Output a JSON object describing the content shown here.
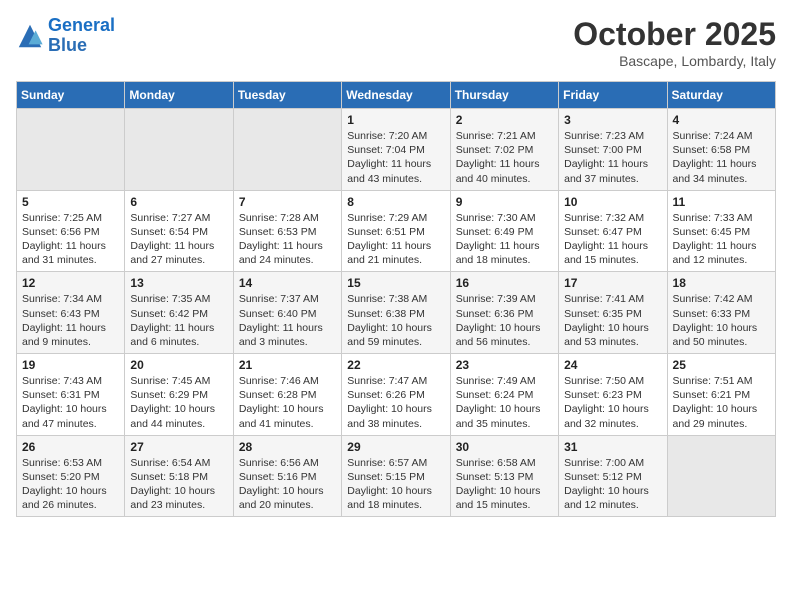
{
  "logo": {
    "line1": "General",
    "line2": "Blue"
  },
  "header": {
    "title": "October 2025",
    "subtitle": "Bascape, Lombardy, Italy"
  },
  "weekdays": [
    "Sunday",
    "Monday",
    "Tuesday",
    "Wednesday",
    "Thursday",
    "Friday",
    "Saturday"
  ],
  "weeks": [
    [
      {
        "day": "",
        "info": ""
      },
      {
        "day": "",
        "info": ""
      },
      {
        "day": "",
        "info": ""
      },
      {
        "day": "1",
        "info": "Sunrise: 7:20 AM\nSunset: 7:04 PM\nDaylight: 11 hours and 43 minutes."
      },
      {
        "day": "2",
        "info": "Sunrise: 7:21 AM\nSunset: 7:02 PM\nDaylight: 11 hours and 40 minutes."
      },
      {
        "day": "3",
        "info": "Sunrise: 7:23 AM\nSunset: 7:00 PM\nDaylight: 11 hours and 37 minutes."
      },
      {
        "day": "4",
        "info": "Sunrise: 7:24 AM\nSunset: 6:58 PM\nDaylight: 11 hours and 34 minutes."
      }
    ],
    [
      {
        "day": "5",
        "info": "Sunrise: 7:25 AM\nSunset: 6:56 PM\nDaylight: 11 hours and 31 minutes."
      },
      {
        "day": "6",
        "info": "Sunrise: 7:27 AM\nSunset: 6:54 PM\nDaylight: 11 hours and 27 minutes."
      },
      {
        "day": "7",
        "info": "Sunrise: 7:28 AM\nSunset: 6:53 PM\nDaylight: 11 hours and 24 minutes."
      },
      {
        "day": "8",
        "info": "Sunrise: 7:29 AM\nSunset: 6:51 PM\nDaylight: 11 hours and 21 minutes."
      },
      {
        "day": "9",
        "info": "Sunrise: 7:30 AM\nSunset: 6:49 PM\nDaylight: 11 hours and 18 minutes."
      },
      {
        "day": "10",
        "info": "Sunrise: 7:32 AM\nSunset: 6:47 PM\nDaylight: 11 hours and 15 minutes."
      },
      {
        "day": "11",
        "info": "Sunrise: 7:33 AM\nSunset: 6:45 PM\nDaylight: 11 hours and 12 minutes."
      }
    ],
    [
      {
        "day": "12",
        "info": "Sunrise: 7:34 AM\nSunset: 6:43 PM\nDaylight: 11 hours and 9 minutes."
      },
      {
        "day": "13",
        "info": "Sunrise: 7:35 AM\nSunset: 6:42 PM\nDaylight: 11 hours and 6 minutes."
      },
      {
        "day": "14",
        "info": "Sunrise: 7:37 AM\nSunset: 6:40 PM\nDaylight: 11 hours and 3 minutes."
      },
      {
        "day": "15",
        "info": "Sunrise: 7:38 AM\nSunset: 6:38 PM\nDaylight: 10 hours and 59 minutes."
      },
      {
        "day": "16",
        "info": "Sunrise: 7:39 AM\nSunset: 6:36 PM\nDaylight: 10 hours and 56 minutes."
      },
      {
        "day": "17",
        "info": "Sunrise: 7:41 AM\nSunset: 6:35 PM\nDaylight: 10 hours and 53 minutes."
      },
      {
        "day": "18",
        "info": "Sunrise: 7:42 AM\nSunset: 6:33 PM\nDaylight: 10 hours and 50 minutes."
      }
    ],
    [
      {
        "day": "19",
        "info": "Sunrise: 7:43 AM\nSunset: 6:31 PM\nDaylight: 10 hours and 47 minutes."
      },
      {
        "day": "20",
        "info": "Sunrise: 7:45 AM\nSunset: 6:29 PM\nDaylight: 10 hours and 44 minutes."
      },
      {
        "day": "21",
        "info": "Sunrise: 7:46 AM\nSunset: 6:28 PM\nDaylight: 10 hours and 41 minutes."
      },
      {
        "day": "22",
        "info": "Sunrise: 7:47 AM\nSunset: 6:26 PM\nDaylight: 10 hours and 38 minutes."
      },
      {
        "day": "23",
        "info": "Sunrise: 7:49 AM\nSunset: 6:24 PM\nDaylight: 10 hours and 35 minutes."
      },
      {
        "day": "24",
        "info": "Sunrise: 7:50 AM\nSunset: 6:23 PM\nDaylight: 10 hours and 32 minutes."
      },
      {
        "day": "25",
        "info": "Sunrise: 7:51 AM\nSunset: 6:21 PM\nDaylight: 10 hours and 29 minutes."
      }
    ],
    [
      {
        "day": "26",
        "info": "Sunrise: 6:53 AM\nSunset: 5:20 PM\nDaylight: 10 hours and 26 minutes."
      },
      {
        "day": "27",
        "info": "Sunrise: 6:54 AM\nSunset: 5:18 PM\nDaylight: 10 hours and 23 minutes."
      },
      {
        "day": "28",
        "info": "Sunrise: 6:56 AM\nSunset: 5:16 PM\nDaylight: 10 hours and 20 minutes."
      },
      {
        "day": "29",
        "info": "Sunrise: 6:57 AM\nSunset: 5:15 PM\nDaylight: 10 hours and 18 minutes."
      },
      {
        "day": "30",
        "info": "Sunrise: 6:58 AM\nSunset: 5:13 PM\nDaylight: 10 hours and 15 minutes."
      },
      {
        "day": "31",
        "info": "Sunrise: 7:00 AM\nSunset: 5:12 PM\nDaylight: 10 hours and 12 minutes."
      },
      {
        "day": "",
        "info": ""
      }
    ]
  ]
}
